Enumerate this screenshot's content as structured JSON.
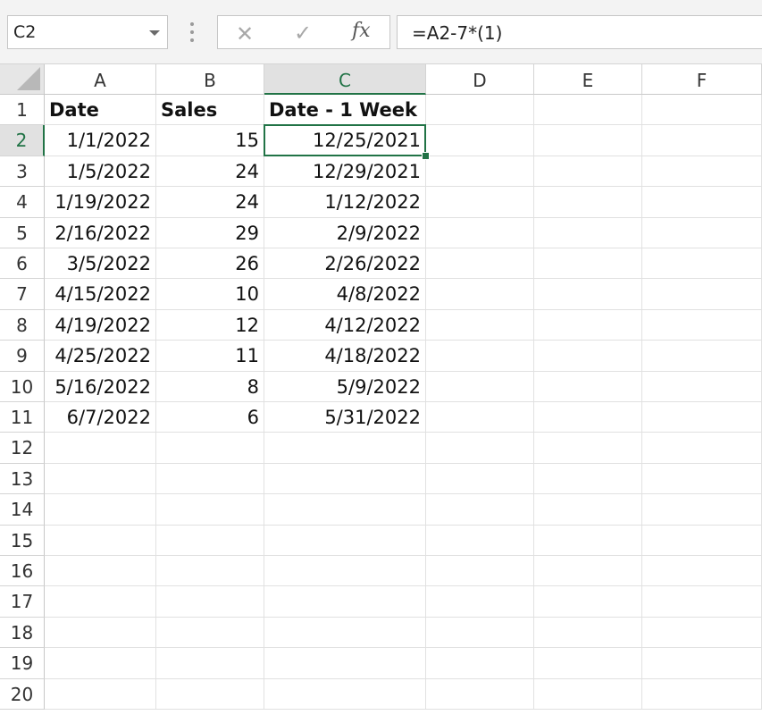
{
  "name_box": {
    "value": "C2"
  },
  "formula_bar": {
    "cancel_glyph": "✕",
    "enter_glyph": "✓",
    "fx_label": "fx",
    "formula": "=A2-7*(1)"
  },
  "columns": [
    "A",
    "B",
    "C",
    "D",
    "E",
    "F"
  ],
  "selected_cell": {
    "col": "C",
    "row": 2
  },
  "rows": [
    {
      "n": "1",
      "a": "Date",
      "b": "Sales",
      "c": "Date - 1 Week"
    },
    {
      "n": "2",
      "a": "1/1/2022",
      "b": "15",
      "c": "12/25/2021"
    },
    {
      "n": "3",
      "a": "1/5/2022",
      "b": "24",
      "c": "12/29/2021"
    },
    {
      "n": "4",
      "a": "1/19/2022",
      "b": "24",
      "c": "1/12/2022"
    },
    {
      "n": "5",
      "a": "2/16/2022",
      "b": "29",
      "c": "2/9/2022"
    },
    {
      "n": "6",
      "a": "3/5/2022",
      "b": "26",
      "c": "2/26/2022"
    },
    {
      "n": "7",
      "a": "4/15/2022",
      "b": "10",
      "c": "4/8/2022"
    },
    {
      "n": "8",
      "a": "4/19/2022",
      "b": "12",
      "c": "4/12/2022"
    },
    {
      "n": "9",
      "a": "4/25/2022",
      "b": "11",
      "c": "4/18/2022"
    },
    {
      "n": "10",
      "a": "5/16/2022",
      "b": "8",
      "c": "5/9/2022"
    },
    {
      "n": "11",
      "a": "6/7/2022",
      "b": "6",
      "c": "5/31/2022"
    },
    {
      "n": "12",
      "a": "",
      "b": "",
      "c": ""
    },
    {
      "n": "13",
      "a": "",
      "b": "",
      "c": ""
    },
    {
      "n": "14",
      "a": "",
      "b": "",
      "c": ""
    },
    {
      "n": "15",
      "a": "",
      "b": "",
      "c": ""
    },
    {
      "n": "16",
      "a": "",
      "b": "",
      "c": ""
    },
    {
      "n": "17",
      "a": "",
      "b": "",
      "c": ""
    },
    {
      "n": "18",
      "a": "",
      "b": "",
      "c": ""
    },
    {
      "n": "19",
      "a": "",
      "b": "",
      "c": ""
    },
    {
      "n": "20",
      "a": "",
      "b": "",
      "c": ""
    }
  ],
  "colors": {
    "selection": "#217346",
    "header_selected_bg": "#e1e1e1"
  }
}
